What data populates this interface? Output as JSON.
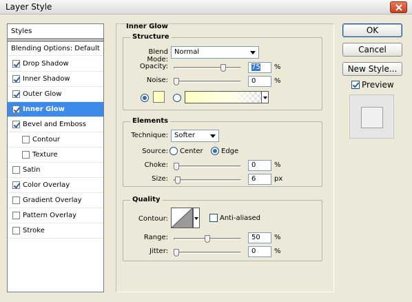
{
  "window": {
    "title": "Layer Style"
  },
  "styles_list": {
    "header": "Styles",
    "blending": "Blending Options: Default",
    "items": [
      {
        "label": "Drop Shadow",
        "checked": true,
        "indent": false,
        "selected": false
      },
      {
        "label": "Inner Shadow",
        "checked": true,
        "indent": false,
        "selected": false
      },
      {
        "label": "Outer Glow",
        "checked": true,
        "indent": false,
        "selected": false
      },
      {
        "label": "Inner Glow",
        "checked": true,
        "indent": false,
        "selected": true
      },
      {
        "label": "Bevel and Emboss",
        "checked": true,
        "indent": false,
        "selected": false
      },
      {
        "label": "Contour",
        "checked": false,
        "indent": true,
        "selected": false
      },
      {
        "label": "Texture",
        "checked": false,
        "indent": true,
        "selected": false
      },
      {
        "label": "Satin",
        "checked": false,
        "indent": false,
        "selected": false
      },
      {
        "label": "Color Overlay",
        "checked": true,
        "indent": false,
        "selected": false
      },
      {
        "label": "Gradient Overlay",
        "checked": false,
        "indent": false,
        "selected": false
      },
      {
        "label": "Pattern Overlay",
        "checked": false,
        "indent": false,
        "selected": false
      },
      {
        "label": "Stroke",
        "checked": false,
        "indent": false,
        "selected": false
      }
    ]
  },
  "panel": {
    "title": "Inner Glow",
    "structure": {
      "title": "Structure",
      "blend_mode_label": "Blend Mode:",
      "blend_mode": "Normal",
      "opacity_label": "Opacity:",
      "opacity": "75",
      "noise_label": "Noise:",
      "noise": "0",
      "percent": "%",
      "glow_color": "#ffffc0",
      "source_mode": "color"
    },
    "elements": {
      "title": "Elements",
      "technique_label": "Technique:",
      "technique": "Softer",
      "source_label": "Source:",
      "source_center": "Center",
      "source_edge": "Edge",
      "choke_label": "Choke:",
      "choke": "0",
      "size_label": "Size:",
      "size": "6",
      "percent": "%",
      "px": "px"
    },
    "quality": {
      "title": "Quality",
      "contour_label": "Contour:",
      "anti_aliased": "Anti-aliased",
      "range_label": "Range:",
      "range": "50",
      "jitter_label": "Jitter:",
      "jitter": "0",
      "percent": "%"
    }
  },
  "buttons": {
    "ok": "OK",
    "cancel": "Cancel",
    "new_style": "New Style...",
    "preview": "Preview"
  }
}
